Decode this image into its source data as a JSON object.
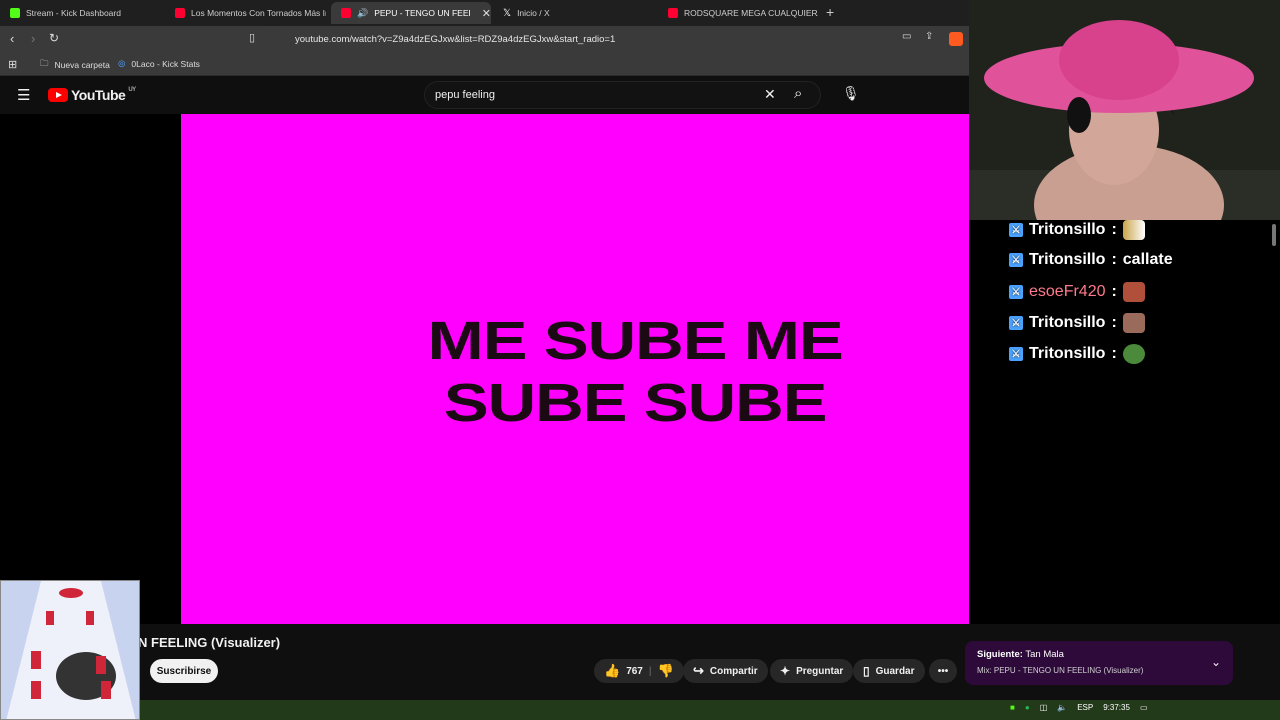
{
  "browser": {
    "tabs": [
      {
        "label": "Stream - Kick Dashboard",
        "color": "#53fc18"
      },
      {
        "label": "Los Momentos Con Tornados Más In",
        "color": "#ff0033"
      },
      {
        "label": "PEPU - TENGO UN FEELING (",
        "color": "#ff0033"
      },
      {
        "label": "Inicio / X",
        "color": "#ffffff"
      },
      {
        "label": "RODSQUARE MEGA CUALQUIERA AL",
        "color": "#ff0033"
      }
    ],
    "url": "youtube.com/watch?v=Z9a4dzEGJxw&list=RDZ9a4dzEGJxw&start_radio=1",
    "bookmarks": [
      "Nueva carpeta",
      "0Laco - Kick Stats"
    ]
  },
  "youtube": {
    "logo_text": "YouTube",
    "region": "UY",
    "search_value": "pepu feeling",
    "video_text_line1": "ME SUBE ME",
    "video_text_line2": "SUBE SUBE",
    "title_fragment": "N FEELING (Visualizer)",
    "subscribe": "Suscribirse",
    "likes": "767",
    "share": "Compartir",
    "ask": "Preguntar",
    "save": "Guardar",
    "next_label": "Siguiente:",
    "next_title": "Tan Mala",
    "mix_text": "Mix: PEPU - TENGO UN FEELING (Visualizer)"
  },
  "chat": [
    {
      "user": "Tritonsillo",
      "text": "",
      "user_color": "#ffffff"
    },
    {
      "user": "Tritonsillo",
      "text": "callate",
      "user_color": "#ffffff"
    },
    {
      "user": "esoeFr420",
      "text": "",
      "user_color": "#ff7a8a"
    },
    {
      "user": "Tritonsillo",
      "text": "",
      "user_color": "#ffffff"
    },
    {
      "user": "Tritonsillo",
      "text": "",
      "user_color": "#ffffff"
    }
  ],
  "taskbar": {
    "lang": "ESP",
    "time": "9:37:35"
  }
}
